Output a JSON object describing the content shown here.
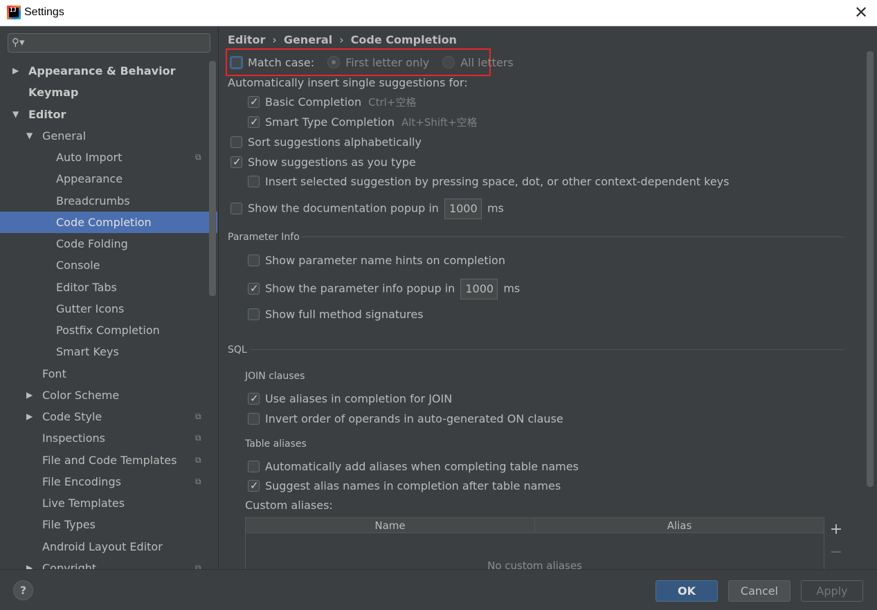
{
  "window": {
    "title": "Settings",
    "close_glyph": "✕"
  },
  "search": {
    "placeholder": ""
  },
  "tree": [
    {
      "label": "Appearance & Behavior",
      "bold": true
    },
    {
      "label": "Keymap",
      "bold": true
    },
    {
      "label": "Editor",
      "bold": true
    },
    {
      "label": "General"
    },
    {
      "label": "Auto Import"
    },
    {
      "label": "Appearance"
    },
    {
      "label": "Breadcrumbs"
    },
    {
      "label": "Code Completion",
      "selected": true
    },
    {
      "label": "Code Folding"
    },
    {
      "label": "Console"
    },
    {
      "label": "Editor Tabs"
    },
    {
      "label": "Gutter Icons"
    },
    {
      "label": "Postfix Completion"
    },
    {
      "label": "Smart Keys"
    },
    {
      "label": "Font"
    },
    {
      "label": "Color Scheme"
    },
    {
      "label": "Code Style"
    },
    {
      "label": "Inspections"
    },
    {
      "label": "File and Code Templates"
    },
    {
      "label": "File Encodings"
    },
    {
      "label": "Live Templates"
    },
    {
      "label": "File Types"
    },
    {
      "label": "Android Layout Editor"
    },
    {
      "label": "Copyright"
    }
  ],
  "breadcrumb": [
    "Editor",
    "General",
    "Code Completion"
  ],
  "content": {
    "match_case": "Match case:",
    "first_letter_only": "First letter only",
    "all_letters": "All letters",
    "auto_insert_heading": "Automatically insert single suggestions for:",
    "basic_completion": "Basic Completion",
    "basic_shortcut": "Ctrl+空格",
    "smart_type_completion": "Smart Type Completion",
    "smart_shortcut": "Alt+Shift+空格",
    "sort_alpha": "Sort suggestions alphabetically",
    "show_as_type": "Show suggestions as you type",
    "insert_selected": "Insert selected suggestion by pressing space, dot, or other context-dependent keys",
    "doc_popup": "Show the documentation popup in",
    "doc_popup_value": "1000",
    "doc_popup_unit": "ms"
  },
  "parameter_info": {
    "title": "Parameter Info",
    "name_hints": "Show parameter name hints on completion",
    "info_popup": "Show the parameter info popup in",
    "info_popup_value": "1000",
    "info_popup_unit": "ms",
    "full_signatures": "Show full method signatures"
  },
  "sql": {
    "title": "SQL",
    "join_title": "JOIN clauses",
    "use_aliases": "Use aliases in completion for JOIN",
    "invert_order": "Invert order of operands in auto-generated ON clause",
    "table_aliases_title": "Table aliases",
    "auto_add_aliases": "Automatically add aliases when completing table names",
    "suggest_alias": "Suggest alias names in completion after table names",
    "custom_aliases": "Custom aliases:",
    "table_headers": [
      "Name",
      "Alias"
    ],
    "table_empty": "No custom aliases",
    "add_glyph": "+",
    "remove_glyph": "−"
  },
  "buttons": {
    "help": "?",
    "ok": "OK",
    "cancel": "Cancel",
    "apply": "Apply"
  },
  "colors": {
    "selection": "#4b6eaf",
    "highlight_box": "#e8262c",
    "ok_button": "#365880"
  }
}
